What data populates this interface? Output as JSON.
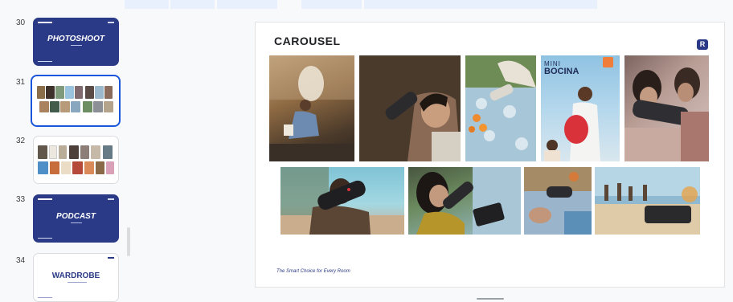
{
  "filmstrip": {
    "slides": [
      {
        "number": "30",
        "kind": "title",
        "title": "PHOTOSHOOT"
      },
      {
        "number": "31",
        "kind": "photos",
        "selected": true
      },
      {
        "number": "32",
        "kind": "photos"
      },
      {
        "number": "33",
        "kind": "title",
        "title": "PODCAST"
      },
      {
        "number": "34",
        "kind": "white-title",
        "title": "WARDROBE"
      }
    ]
  },
  "slide": {
    "title": "CAROUSEL",
    "logo_letter": "R",
    "tagline": "The Smart Choice for Every Room",
    "photo_labels": {
      "mini": "MINI",
      "bocina": "BOCINA"
    }
  },
  "colors": {
    "brand_blue": "#2b3a86",
    "selection_blue": "#1a56db",
    "canvas_bg": "#ffffff",
    "app_bg": "#f8f9fa"
  }
}
